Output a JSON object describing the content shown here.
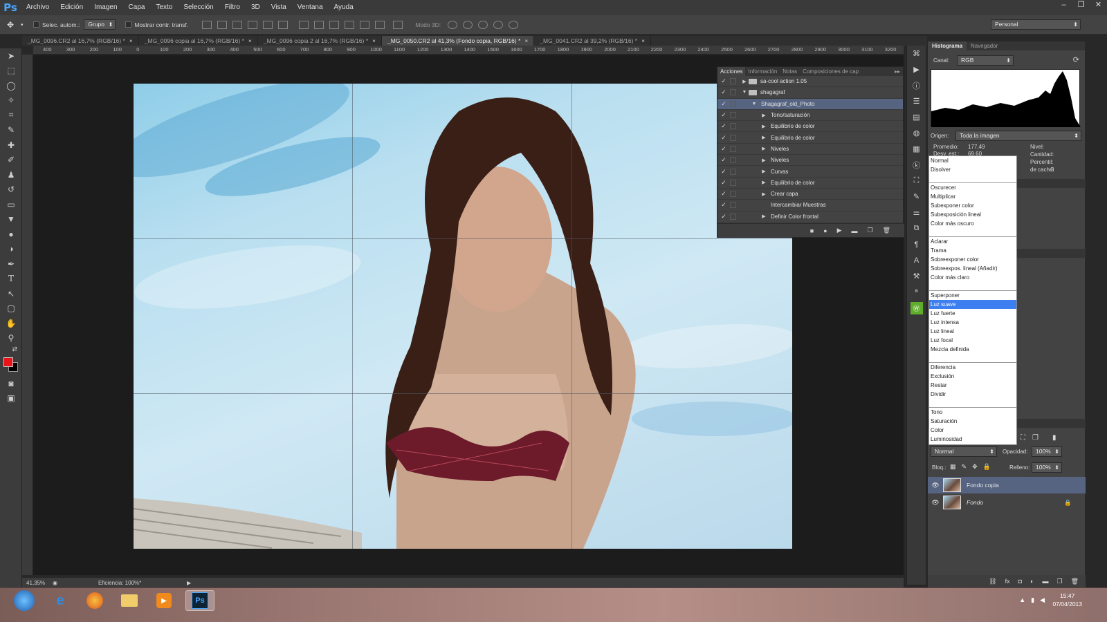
{
  "menu": [
    "Archivo",
    "Edición",
    "Imagen",
    "Capa",
    "Texto",
    "Selección",
    "Filtro",
    "3D",
    "Vista",
    "Ventana",
    "Ayuda"
  ],
  "app_logo": "Ps",
  "window_controls": [
    "–",
    "❐",
    "✕"
  ],
  "options": {
    "auto_select": "Selec. autom.:",
    "group_combo": "Grupo",
    "show_transform": "Mostrar contr. transf.",
    "mode_3d": "Modo 3D:",
    "workspace": "Personal"
  },
  "tabs": [
    {
      "label": "_MG_0096.CR2 al 16,7% (RGB/16) *",
      "active": false
    },
    {
      "label": "_MG_0096 copia al 16,7% (RGB/16) *",
      "active": false
    },
    {
      "label": "_MG_0096 copia 2 al 16,7% (RGB/16) *",
      "active": false
    },
    {
      "label": "_MG_0050.CR2 al 41,3% (Fondo copia, RGB/16) *",
      "active": true
    },
    {
      "label": "_MG_0041.CR2 al 39,2% (RGB/16) *",
      "active": false
    }
  ],
  "hruler_labels": [
    "400",
    "300",
    "200",
    "100",
    "0",
    "100",
    "200",
    "300",
    "400",
    "500",
    "600",
    "700",
    "800",
    "900",
    "1000",
    "1100",
    "1200",
    "1300",
    "1400",
    "1500",
    "1600",
    "1700",
    "1800",
    "1900",
    "2000",
    "2100",
    "2200",
    "2300",
    "2400",
    "2500",
    "2600",
    "2700",
    "2800",
    "2900",
    "3000",
    "3100",
    "3200"
  ],
  "actions_panel": {
    "tabs": [
      "Acciones",
      "Información",
      "Notas",
      "Composiciones de cap"
    ],
    "rows": [
      {
        "label": "sa-cool action 1.05",
        "indent": 0,
        "type": "set",
        "expanded": false,
        "selected": false
      },
      {
        "label": "shagagraf",
        "indent": 0,
        "type": "set",
        "expanded": true,
        "selected": false
      },
      {
        "label": "Shagagraf_old_Photo",
        "indent": 1,
        "type": "action",
        "expanded": true,
        "selected": true
      },
      {
        "label": "Tono/saturación",
        "indent": 2,
        "type": "step",
        "expanded": false,
        "selected": false
      },
      {
        "label": "Equilibrio de color",
        "indent": 2,
        "type": "step",
        "expanded": false,
        "selected": false
      },
      {
        "label": "Equilibrio de color",
        "indent": 2,
        "type": "step",
        "expanded": false,
        "selected": false
      },
      {
        "label": "Niveles",
        "indent": 2,
        "type": "step",
        "expanded": false,
        "selected": false
      },
      {
        "label": "Niveles",
        "indent": 2,
        "type": "step",
        "expanded": false,
        "selected": false
      },
      {
        "label": "Curvas",
        "indent": 2,
        "type": "step",
        "expanded": false,
        "selected": false
      },
      {
        "label": "Equilibrio de color",
        "indent": 2,
        "type": "step",
        "expanded": false,
        "selected": false
      },
      {
        "label": "Crear capa",
        "indent": 2,
        "type": "step",
        "expanded": false,
        "selected": false
      },
      {
        "label": "Intercambiar Muestras",
        "indent": 2,
        "type": "plain",
        "expanded": false,
        "selected": false
      },
      {
        "label": "Definir Color frontal",
        "indent": 2,
        "type": "step",
        "expanded": false,
        "selected": false
      }
    ]
  },
  "histogram": {
    "tabs": [
      "Histograma",
      "Navegador"
    ],
    "channel_label": "Canal:",
    "channel_value": "RGB",
    "source_label": "Origen:",
    "source_value": "Toda la imagen",
    "mean_label": "Promedio:",
    "mean_value": "177,49",
    "dev_label": "Desv. est.:",
    "dev_value": "69,60",
    "level_label": "Nivel:",
    "count_label": "Cantidad:",
    "percentile_label": "Percentil:",
    "cache_label": "de caché:",
    "cache_value": "3"
  },
  "blend_modes": [
    [
      "Normal",
      "Disolver"
    ],
    [
      "Oscurecer",
      "Multiplicar",
      "Subexponer color",
      "Subexposición lineal",
      "Color más oscuro"
    ],
    [
      "Aclarar",
      "Trama",
      "Sobreexponer color",
      "Sobreexpos. lineal (Añadir)",
      "Color más claro"
    ],
    [
      "Superponer",
      "Luz suave",
      "Luz fuerte",
      "Luz intensa",
      "Luz lineal",
      "Luz focal",
      "Mezcla definida"
    ],
    [
      "Diferencia",
      "Exclusión",
      "Restar",
      "Dividir"
    ],
    [
      "Tono",
      "Saturación",
      "Color",
      "Luminosidad"
    ]
  ],
  "blend_selected": "Luz suave",
  "layers": {
    "blend_value": "Normal",
    "opacity_label": "Opacidad:",
    "opacity_value": "100%",
    "lock_label": "Bloq.:",
    "fill_label": "Relleno:",
    "fill_value": "100%",
    "items": [
      {
        "name": "Fondo copia",
        "selected": true,
        "locked": false
      },
      {
        "name": "Fondo",
        "selected": false,
        "locked": true
      }
    ]
  },
  "status": {
    "zoom": "41,35%",
    "efficiency": "Eficiencia: 100%*"
  },
  "taskbar": {
    "time": "15:47",
    "date": "07/04/2013"
  },
  "colors": {
    "foreground": "#e8141a",
    "background": "#000000",
    "selection": "#566481",
    "menu_highlight": "#3d7ff0"
  }
}
